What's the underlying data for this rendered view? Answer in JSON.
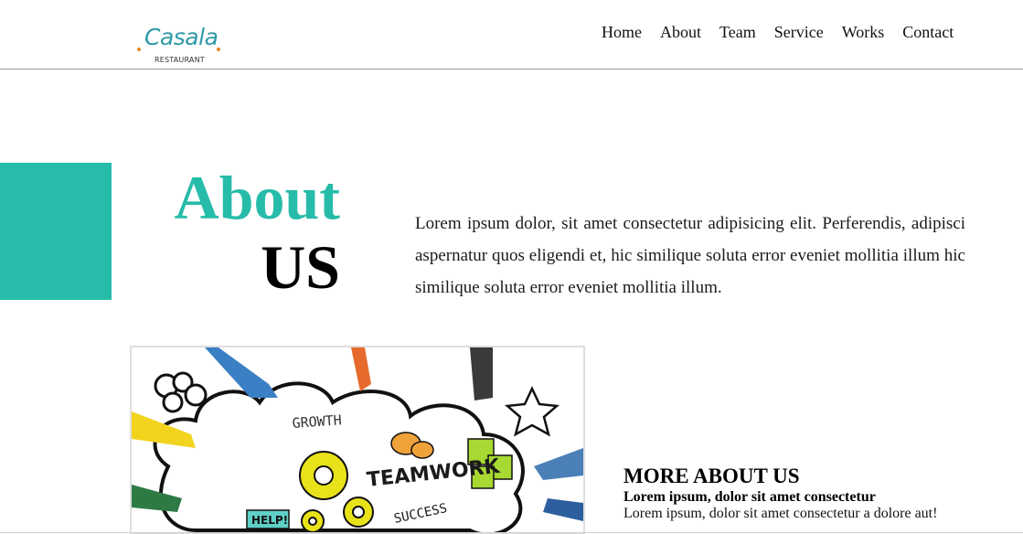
{
  "brand": {
    "name": "Casala",
    "tagline": "RESTAURANT",
    "accent_color": "#26bca9",
    "logo_color": "#2f9aa8",
    "dot_color": "#e38a1f"
  },
  "nav": {
    "items": [
      {
        "label": "Home"
      },
      {
        "label": "About"
      },
      {
        "label": "Team"
      },
      {
        "label": "Service"
      },
      {
        "label": "Works"
      },
      {
        "label": "Contact"
      }
    ]
  },
  "about": {
    "heading_line1": "About",
    "heading_line2": "US",
    "intro": "Lorem ipsum dolor, sit amet consectetur adipisicing elit. Perferendis, adipisci aspernatur quos eligendi et, hic similique soluta error eveniet mollitia illum hic similique soluta error eveniet mollitia illum."
  },
  "image": {
    "labels": {
      "growth": "GROWTH",
      "teamwork": "TEAMWORK",
      "success": "SUCCESS",
      "help": "HELP!"
    }
  },
  "more": {
    "title": "MORE ABOUT US",
    "subtitle": "Lorem ipsum, dolor sit amet consectetur",
    "body": "Lorem ipsum, dolor sit amet consectetur a dolore aut!"
  }
}
